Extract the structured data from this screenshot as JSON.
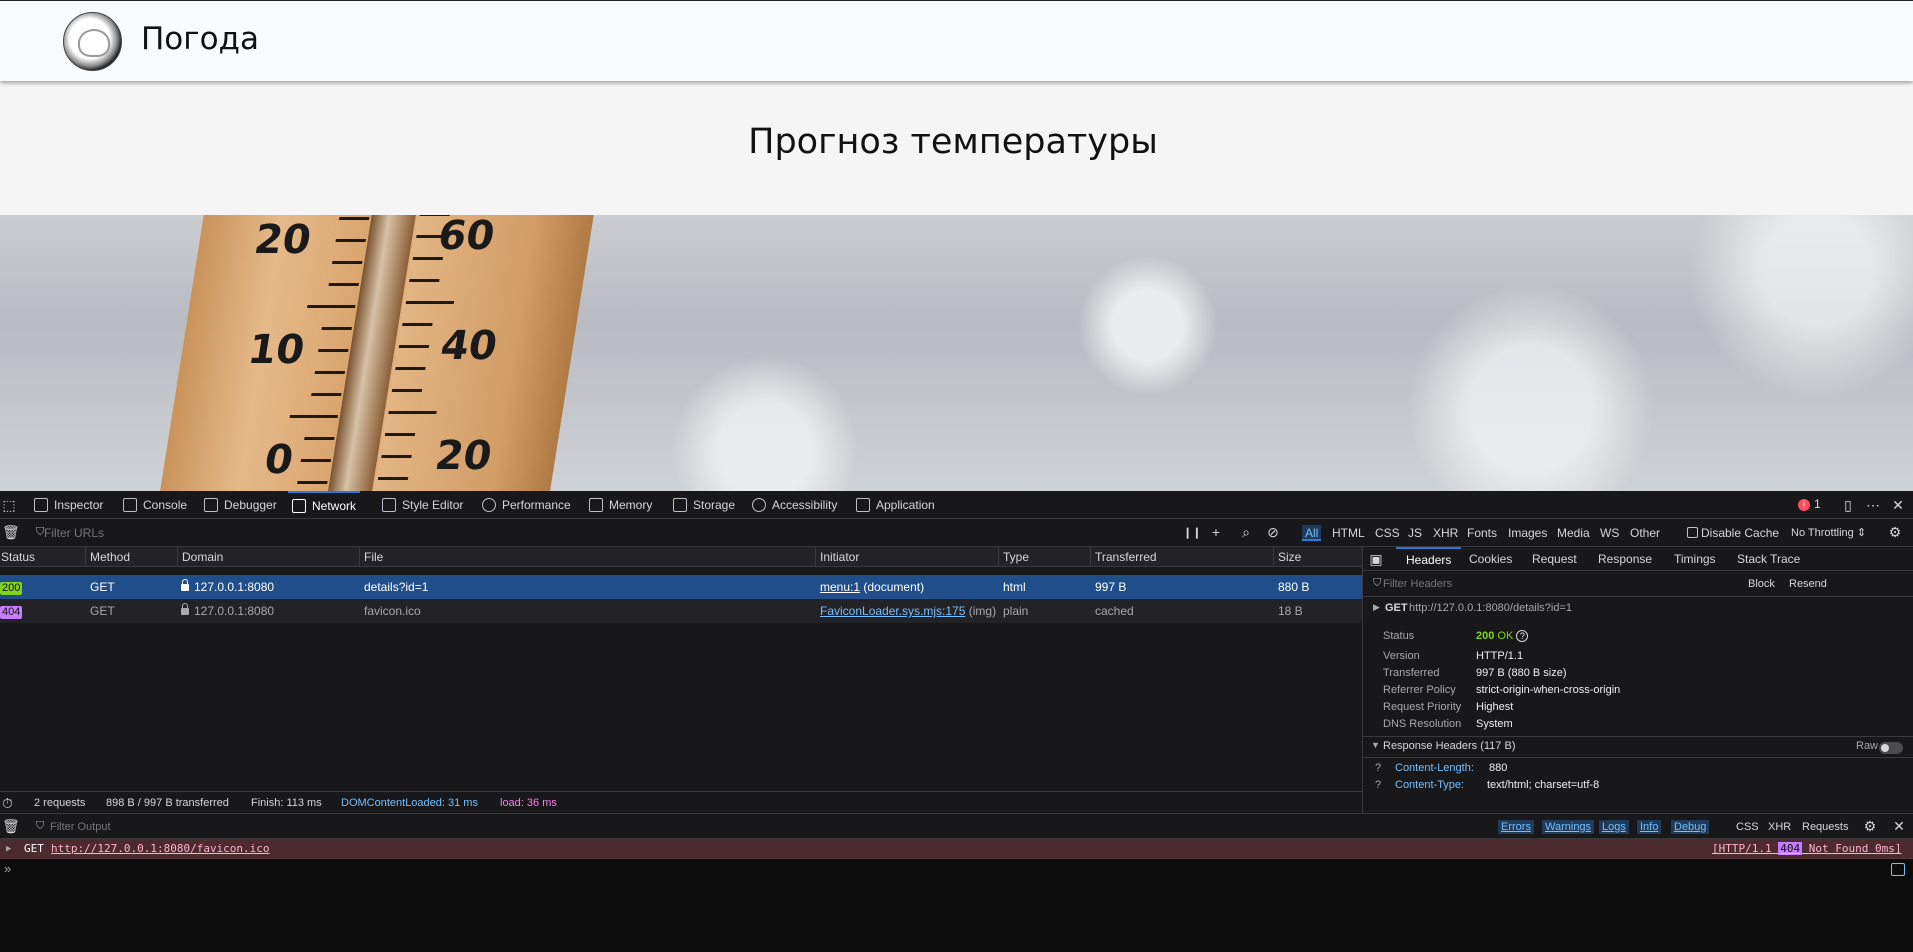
{
  "site": {
    "title": "Погода",
    "hero_title": "Прогноз температуры",
    "thermometer_left_numbers": [
      "20",
      "10",
      "0"
    ],
    "thermometer_right_numbers": [
      "60",
      "40",
      "20"
    ]
  },
  "devtools": {
    "tabs": [
      "Inspector",
      "Console",
      "Debugger",
      "Network",
      "Style Editor",
      "Performance",
      "Memory",
      "Storage",
      "Accessibility",
      "Application"
    ],
    "selected_tab": "Network",
    "error_count": "1",
    "network": {
      "filter_placeholder": "Filter URLs",
      "type_filters": [
        "All",
        "HTML",
        "CSS",
        "JS",
        "XHR",
        "Fonts",
        "Images",
        "Media",
        "WS",
        "Other"
      ],
      "disable_cache": "Disable Cache",
      "throttling": "No Throttling",
      "columns": [
        "Status",
        "Method",
        "Domain",
        "File",
        "Initiator",
        "Type",
        "Transferred",
        "Size"
      ],
      "rows": [
        {
          "status": "200",
          "method": "GET",
          "domain": "127.0.0.1:8080",
          "file": "details?id=1",
          "initiator_link": "menu:1",
          "initiator_note": "(document)",
          "type": "html",
          "transferred": "997 B",
          "size": "880 B"
        },
        {
          "status": "404",
          "method": "GET",
          "domain": "127.0.0.1:8080",
          "file": "favicon.ico",
          "initiator_link": "FaviconLoader.sys.mjs:175",
          "initiator_note": "(img)",
          "type": "plain",
          "transferred": "cached",
          "size": "18 B"
        }
      ],
      "summary": {
        "requests": "2 requests",
        "transferred": "898 B / 997 B transferred",
        "finish": "Finish: 113 ms",
        "dom_loaded": "DOMContentLoaded: 31 ms",
        "load": "load: 36 ms"
      }
    },
    "details": {
      "tabs": [
        "Headers",
        "Cookies",
        "Request",
        "Response",
        "Timings",
        "Stack Trace"
      ],
      "filter_placeholder": "Filter Headers",
      "block": "Block",
      "resend": "Resend",
      "request_line": "GET",
      "request_url": "http://127.0.0.1:8080/details?id=1",
      "status_label": "Status",
      "status_code": "200",
      "status_text": "OK",
      "fields": [
        {
          "k": "Version",
          "v": "HTTP/1.1"
        },
        {
          "k": "Transferred",
          "v": "997 B (880 B size)"
        },
        {
          "k": "Referrer Policy",
          "v": "strict-origin-when-cross-origin"
        },
        {
          "k": "Request Priority",
          "v": "Highest"
        },
        {
          "k": "DNS Resolution",
          "v": "System"
        }
      ],
      "response_headers_title": "Response Headers (117 B)",
      "raw": "Raw",
      "headers": [
        {
          "k": "Content-Length:",
          "v": "880"
        },
        {
          "k": "Content-Type:",
          "v": "text/html; charset=utf-8"
        }
      ]
    },
    "console": {
      "filter_placeholder": "Filter Output",
      "levels": [
        "Errors",
        "Warnings",
        "Logs",
        "Info",
        "Debug"
      ],
      "extra_filters": [
        "CSS",
        "XHR",
        "Requests"
      ],
      "message_method": "GET",
      "message_url": "http://127.0.0.1:8080/favicon.ico",
      "message_proto": "[HTTP/1.1",
      "message_code": "404",
      "message_status": "Not Found 0ms]"
    },
    "colors": {
      "accent": "#2a7bd9",
      "selected_row": "#204e8a",
      "status_200": "#7ed321",
      "status_404": "#c77dff",
      "error_row": "#4b2b2f"
    }
  }
}
